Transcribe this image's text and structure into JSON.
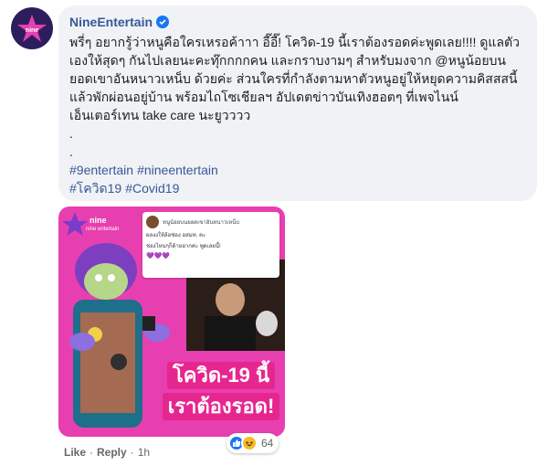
{
  "post": {
    "author": "NineEntertain",
    "text": "พรี่ๆ อยากรู้ว่าหนูคือใครเหรอค้าาา อี๊อี๊! โควิด-19 นี้เราต้องรอดค่ะพูดเลย!!!! ดูแลตัวเองให้สุดๆ กันไปเลยนะคะทุ๊กกกกคน และกราบงามๆ สำหรับมงจาก @หนูน้อยบนยอดเขาอันหนาวเหน็บ ด้วยค่ะ ส่วนใครที่กำลังตามหาตัวหนูอยู่ให้หยุดความคิสสสนี้แล้วพักผ่อนอยู่บ้าน พร้อมไถโซเชียลฯ อัปเดตข่าวบันเทิงฮอตๆ ที่เพจไนน์เอ็นเตอร์เทน take care นะยูวววว",
    "dot1": ".",
    "dot2": ".",
    "hashtags": [
      "#9entertain",
      "#nineentertain",
      "#โควิด19",
      "#Covid19"
    ]
  },
  "media": {
    "brand": "nine entertain",
    "comment_name": "หนูน้อยบนยอดเขาอันหนาวเหน็บ",
    "comment_line1": "ผลงงให้ล้อช่อง อสมท. คะ",
    "comment_line2": "ช่องไหนๆก็ด้ายอากค่ะ พูดเลยนี้!",
    "hearts": "💜💜💜",
    "banner_line1": "โควิด-19 นี้",
    "banner_line2": "เราต้องรอด!"
  },
  "actions": {
    "like": "Like",
    "separator": "·",
    "reply": "Reply",
    "time": "1h"
  },
  "reactions": {
    "count": "64"
  },
  "colors": {
    "link": "#385898",
    "bubble": "#f0f2f5",
    "pink": "#e83fb0"
  }
}
